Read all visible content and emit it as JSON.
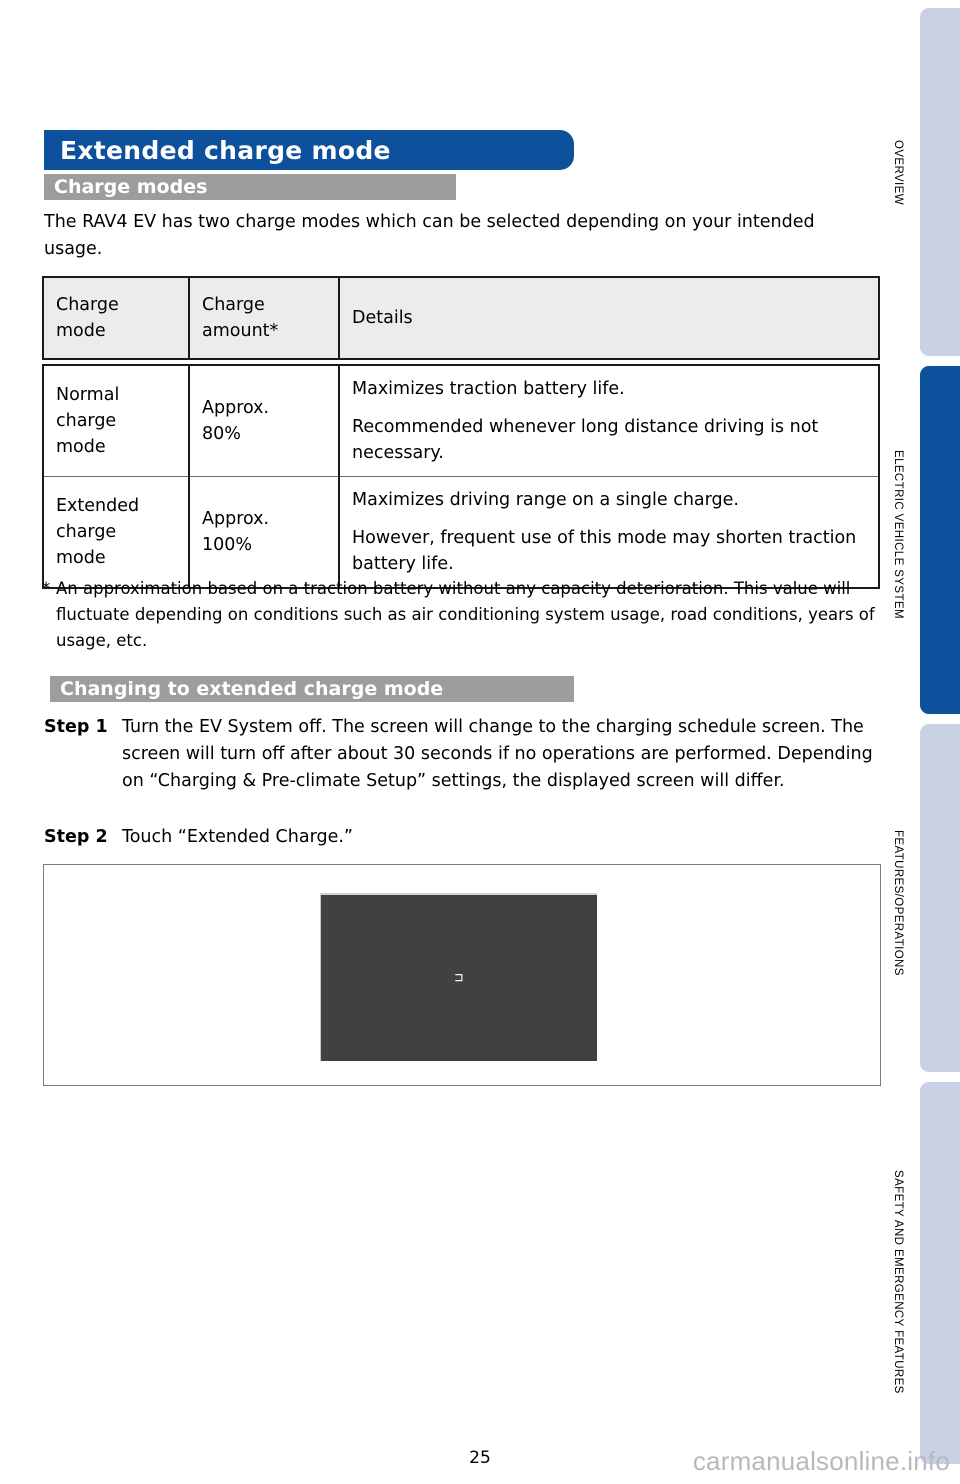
{
  "page": {
    "number": "25",
    "watermark": "carmanualsonline.info"
  },
  "header": {
    "title": "Extended charge mode"
  },
  "sections": {
    "charge_modes_heading": "Charge modes",
    "changing_heading": "Changing to extended charge mode"
  },
  "intro": "The RAV4 EV has two charge modes which can be selected depending on your intended usage.",
  "table": {
    "headers": {
      "mode": "Charge\nmode",
      "mode_line1": "Charge",
      "mode_line2": "mode",
      "amount_line1": "Charge",
      "amount_line2": "amount*",
      "details": "Details"
    },
    "rows": [
      {
        "mode_line1": "Normal",
        "mode_line2": "charge",
        "mode_line3": "mode",
        "amount_line1": "Approx.",
        "amount_line2": "80%",
        "detail1": "Maximizes traction battery life.",
        "detail2": "Recommended whenever long distance driving is not necessary."
      },
      {
        "mode_line1": "Extended",
        "mode_line2": "charge",
        "mode_line3": "mode",
        "amount_line1": "Approx.",
        "amount_line2": "100%",
        "detail1": "Maximizes driving range on a single charge.",
        "detail2": "However, frequent use of this mode may shorten traction battery life."
      }
    ]
  },
  "footnote": {
    "marker": "*",
    "text": "An approximation based on a traction battery without any capacity deterioration. This value will fluctuate depending on conditions such as air conditioning system usage, road conditions, years of usage, etc."
  },
  "steps": [
    {
      "label": "Step 1",
      "text": "Turn the EV System off. The screen will change to the charging schedule screen. The screen will turn off after about 30 seconds if no operations are performed. Depending on “Charging & Pre-climate Setup” settings, the displayed screen will differ."
    },
    {
      "label": "Step 2",
      "text": "Touch “Extended Charge.”"
    }
  ],
  "figure": {
    "screen_glyph": "⊐"
  },
  "sidebar": {
    "tabs": [
      {
        "label": "OVERVIEW",
        "active": false
      },
      {
        "label": "ELECTRIC VEHICLE SYSTEM",
        "active": true
      },
      {
        "label": "FEATURES/OPERATIONS",
        "active": false
      },
      {
        "label": "SAFETY AND EMERGENCY FEATURES",
        "active": false
      }
    ]
  },
  "colors": {
    "brand_blue": "#0d509b",
    "section_gray": "#9d9d9d",
    "tab_inactive": "#c9d2e4",
    "table_header_bg": "#ececec",
    "screen_dark": "#404241"
  }
}
